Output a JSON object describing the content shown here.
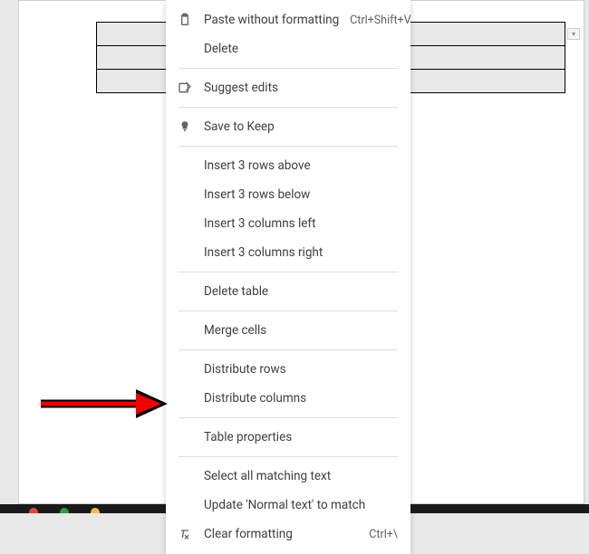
{
  "menu": {
    "paste_without_formatting": {
      "label": "Paste without formatting",
      "shortcut": "Ctrl+Shift+V"
    },
    "delete": {
      "label": "Delete"
    },
    "suggest_edits": {
      "label": "Suggest edits"
    },
    "save_to_keep": {
      "label": "Save to Keep"
    },
    "insert_rows_above": {
      "label": "Insert 3 rows above"
    },
    "insert_rows_below": {
      "label": "Insert 3 rows below"
    },
    "insert_cols_left": {
      "label": "Insert 3 columns left"
    },
    "insert_cols_right": {
      "label": "Insert 3 columns right"
    },
    "delete_table": {
      "label": "Delete table"
    },
    "merge_cells": {
      "label": "Merge cells"
    },
    "distribute_rows": {
      "label": "Distribute rows"
    },
    "distribute_columns": {
      "label": "Distribute columns"
    },
    "table_properties": {
      "label": "Table properties"
    },
    "select_matching": {
      "label": "Select all matching text"
    },
    "update_normal": {
      "label": "Update 'Normal text' to match"
    },
    "clear_formatting": {
      "label": "Clear formatting",
      "shortcut": "Ctrl+\\"
    }
  }
}
